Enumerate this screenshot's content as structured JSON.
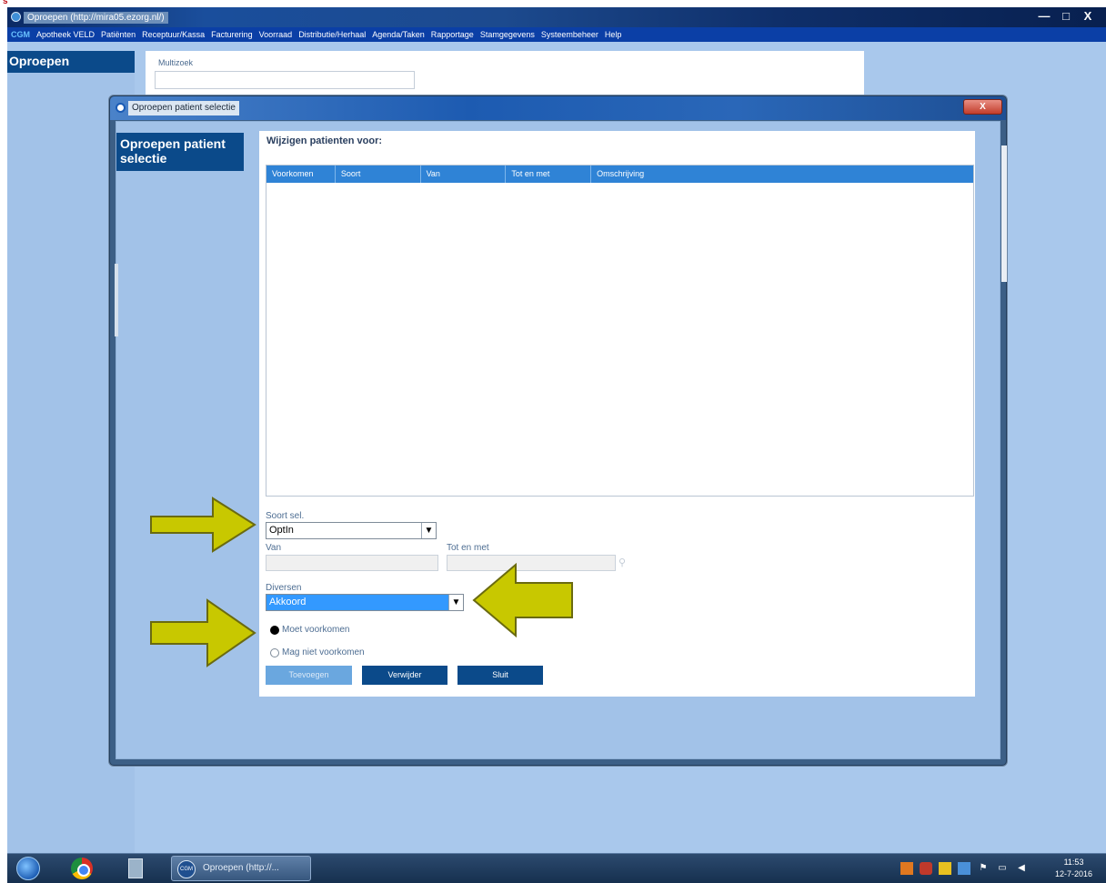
{
  "window": {
    "title": "Oproepen (http://mira05.ezorg.nl/)",
    "buttons": [
      "—",
      "□",
      "X"
    ]
  },
  "menu": {
    "brand": "CGM",
    "items": [
      "Apotheek VELD",
      "Patiënten",
      "Receptuur/Kassa",
      "Facturering",
      "Voorraad",
      "Distributie/Herhaal",
      "Agenda/Taken",
      "Rapportage",
      "Stamgegevens",
      "Systeembeheer",
      "Help"
    ]
  },
  "page": {
    "nav_label": "Oproepen",
    "multizoek_label": "Multizoek"
  },
  "dialog": {
    "title": "Oproepen patient selectie",
    "close_label": "X",
    "nav_label": "Oproepen patient selectie",
    "heading": "Wijzigen patienten voor:",
    "grid_columns": [
      "Voorkomen",
      "Soort",
      "Van",
      "Tot en met",
      "Omschrijving"
    ],
    "soort_sel_label": "Soort sel.",
    "soort_sel_value": "OptIn",
    "van_label": "Van",
    "tot_label": "Tot en met",
    "diversen_label": "Diversen",
    "diversen_value": "Akkoord",
    "radio_moet": "Moet voorkomen",
    "radio_mag_niet": "Mag niet voorkomen",
    "btn_toevoegen": "Toevoegen",
    "btn_verwijder": "Verwijder",
    "btn_sluit": "Sluit"
  },
  "taskbar": {
    "task_label": "Oproepen (http://...",
    "task_icon_label": "CGM",
    "time": "11:53",
    "date": "12-7-2016"
  },
  "colors": {
    "highlight_arrow": "#c8c800",
    "nav_blue": "#0b4a8a",
    "grid_header": "#2f83d6",
    "select_highlight": "#3399ff"
  }
}
